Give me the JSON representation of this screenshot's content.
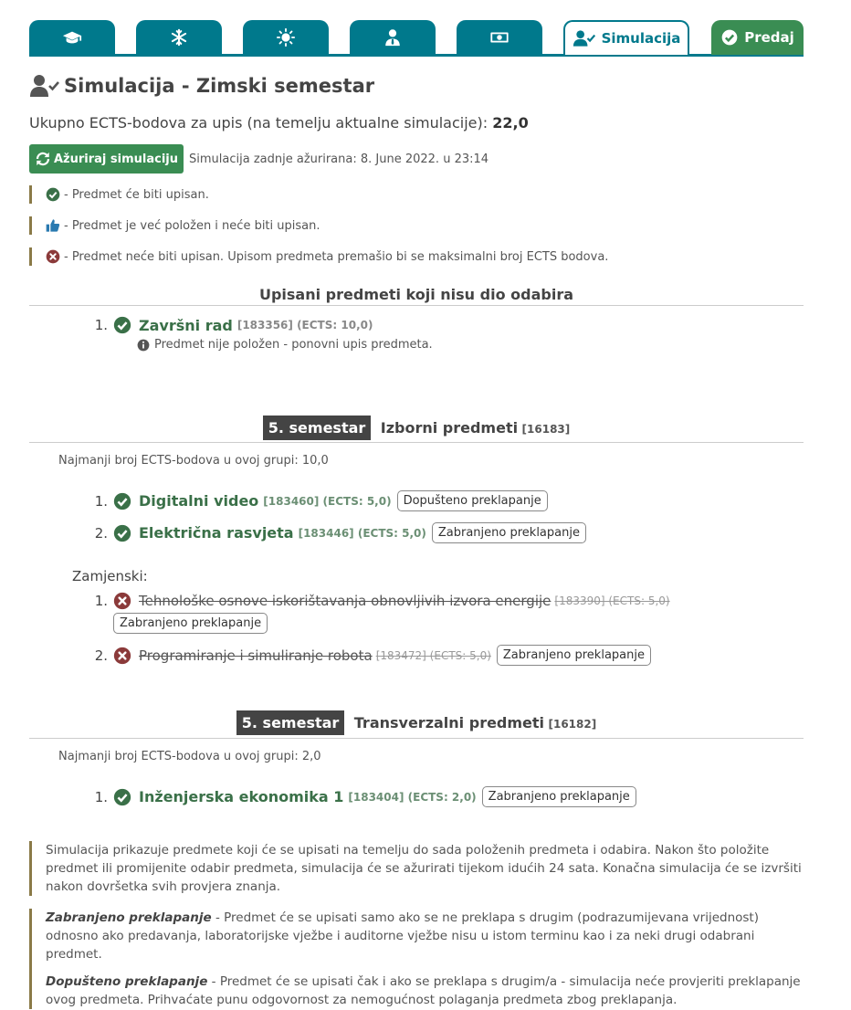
{
  "tabs": {
    "simulation_label": "Simulacija",
    "submit_label": "Predaj",
    "icons": [
      "graduation-cap-icon",
      "snowflake-icon",
      "sun-icon",
      "user-tie-icon",
      "money-bill-icon"
    ]
  },
  "page": {
    "title": "Simulacija - Zimski semestar",
    "ects_text": "Ukupno ECTS-bodova za upis (na temelju aktualne simulacije):",
    "ects_value": "22,0",
    "update_button": "Ažuriraj simulaciju",
    "updated_info": "Simulacija zadnje ažurirana: 8. June 2022. u 23:14"
  },
  "legend": {
    "enrolled": "- Predmet će biti upisan.",
    "passed": "- Predmet je već položen i neće biti upisan.",
    "not_enrolled": "- Predmet neće biti upisan. Upisom predmeta premašio bi se maksimalni broj ECTS bodova."
  },
  "enrolled_section": {
    "title": "Upisani predmeti koji nisu dio odabira",
    "items": [
      {
        "num": "1.",
        "name": "Završni rad",
        "code": "[183356] (ECTS: 10,0)",
        "note": "Predmet nije položen - ponovni upis predmeta."
      }
    ]
  },
  "groups": [
    {
      "semester": "5. semestar",
      "title": "Izborni predmeti",
      "code": "[16183]",
      "min_ects": "Najmanji broj ECTS-bodova u ovoj grupi: 10,0",
      "items": [
        {
          "num": "1.",
          "name": "Digitalni video",
          "code": "[183460] (ECTS: 5,0)",
          "overlap": "Dopušteno preklapanje"
        },
        {
          "num": "2.",
          "name": "Električna rasvjeta",
          "code": "[183446] (ECTS: 5,0)",
          "overlap": "Zabranjeno preklapanje"
        }
      ],
      "substitutes_label": "Zamjenski:",
      "substitutes": [
        {
          "num": "1.",
          "name": "Tehnološke osnove iskorištavanja obnovljivih izvora energije",
          "code": "[183390] (ECTS: 5,0)",
          "overlap": "Zabranjeno preklapanje"
        },
        {
          "num": "2.",
          "name": "Programiranje i simuliranje robota",
          "code": "[183472] (ECTS: 5,0)",
          "overlap": "Zabranjeno preklapanje"
        }
      ]
    },
    {
      "semester": "5. semestar",
      "title": "Transverzalni predmeti",
      "code": "[16182]",
      "min_ects": "Najmanji broj ECTS-bodova u ovoj grupi: 2,0",
      "items": [
        {
          "num": "1.",
          "name": "Inženjerska ekonomika 1",
          "code": "[183404] (ECTS: 2,0)",
          "overlap": "Zabranjeno preklapanje"
        }
      ]
    }
  ],
  "info": {
    "simulation": "Simulacija prikazuje predmete koji će se upisati na temelju do sada položenih predmeta i odabira. Nakon što položite predmet ili promijenite odabir predmeta, simulacija će se ažurirati tijekom idućih 24 sata. Konačna simulacija će se izvršiti nakon dovršetka svih provjera znanja.",
    "forbidden_term": "Zabranjeno preklapanje",
    "forbidden_text": " - Predmet će se upisati samo ako se ne preklapa s drugim (podrazumijevana vrijednost) odnosno ako predavanja, laboratorijske vježbe i auditorne vježbe nisu u istom terminu kao i za neki drugi odabrani predmet.",
    "allowed_term": "Dopušteno preklapanje",
    "allowed_text": " - Predmet će se upisati čak i ako se preklapa s drugim/a - simulacija neće provjeriti preklapanje ovog predmeta. Prihvaćate punu odgovornost za nemogućnost polaganja predmeta zbog preklapanja."
  },
  "colors": {
    "teal": "#00798c",
    "green": "#3a8d53",
    "red": "#8b3a3a",
    "legend_bar": "#8a7a48"
  }
}
